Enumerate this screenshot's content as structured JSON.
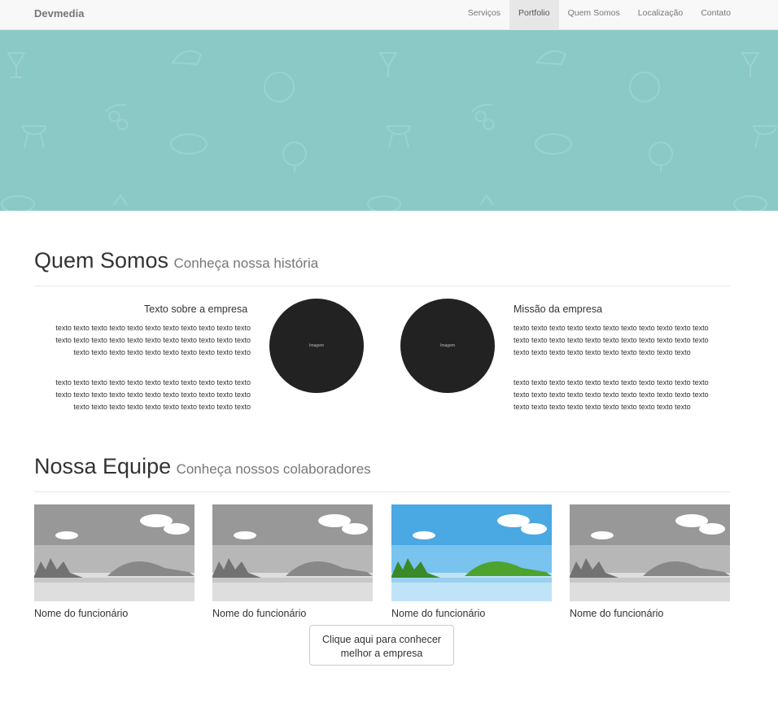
{
  "navbar": {
    "brand": "Devmedia",
    "items": [
      {
        "label": "Serviços",
        "active": false
      },
      {
        "label": "Portfolio",
        "active": true
      },
      {
        "label": "Quem Somos",
        "active": false
      },
      {
        "label": "Localização",
        "active": false
      },
      {
        "label": "Contato",
        "active": false
      }
    ]
  },
  "hero": {
    "background": "#8ac9c6"
  },
  "about": {
    "title": "Quem Somos",
    "subtitle": "Conheça nossa história",
    "left": {
      "title": "Texto sobre a empresa",
      "p1": "texto texto texto texto texto texto texto texto texto texto texto texto texto texto texto texto texto texto texto texto texto texto texto texto texto texto texto texto texto texto texto texto",
      "p2": "texto texto texto texto texto texto texto texto texto texto texto texto texto texto texto texto texto texto texto texto texto texto texto texto texto texto texto texto texto texto texto texto",
      "image_label": "Imagem"
    },
    "right": {
      "title": "Missão da empresa",
      "p1": "texto texto texto texto texto texto texto texto texto texto texto texto texto texto texto texto texto texto texto texto texto texto texto texto texto texto texto texto texto texto texto texto",
      "p2": "texto texto texto texto texto texto texto texto texto texto texto texto texto texto texto texto texto texto texto texto texto texto texto texto texto texto texto texto texto texto texto texto",
      "image_label": "Imagem"
    }
  },
  "team": {
    "title": "Nossa Equipe",
    "subtitle": "Conheça nossos colaboradores",
    "members": [
      {
        "name": "Nome do funcionário",
        "grayscale": true
      },
      {
        "name": "Nome do funcionário",
        "grayscale": true
      },
      {
        "name": "Nome do funcionário",
        "grayscale": false
      },
      {
        "name": "Nome do funcionário",
        "grayscale": true
      }
    ],
    "cta_line1": "Clique aqui para conhecer",
    "cta_line2": "melhor a empresa"
  }
}
